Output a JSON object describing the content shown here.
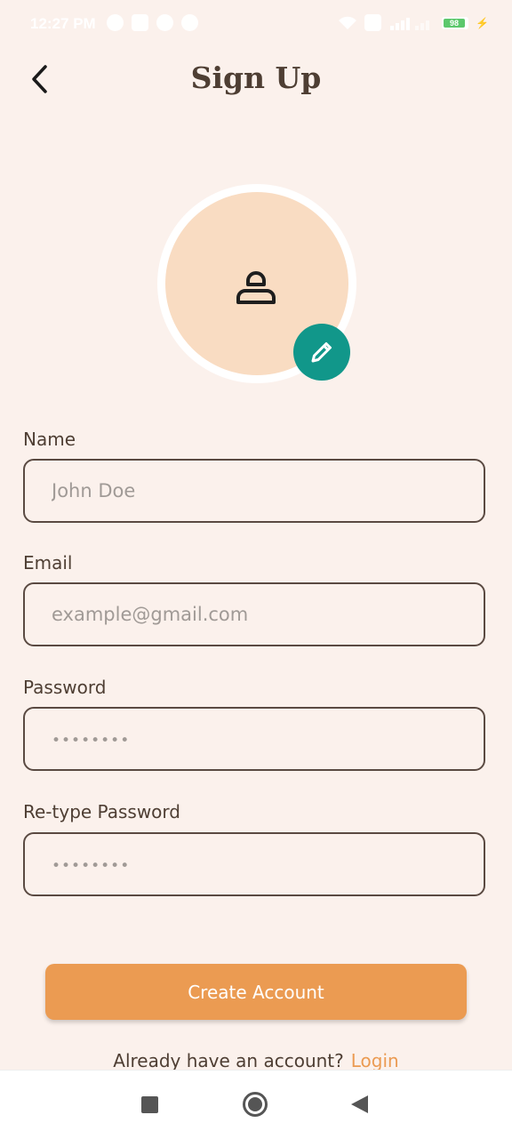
{
  "status_bar": {
    "time": "12:27 PM",
    "battery_level": "98",
    "icons": [
      "alarm-icon",
      "message-icon",
      "settings-icon",
      "chrome-icon",
      "wifi-icon",
      "screen-icon",
      "signal-icon",
      "battery-icon",
      "charging-icon"
    ]
  },
  "header": {
    "title": "Sign Up",
    "back_icon": "chevron-left-icon"
  },
  "avatar": {
    "placeholder_icon": "person-icon",
    "edit_icon": "pencil-icon",
    "edit_button_color": "#11978a",
    "avatar_color": "#f9dcc2"
  },
  "form": {
    "name": {
      "label": "Name",
      "placeholder": "John Doe"
    },
    "email": {
      "label": "Email",
      "placeholder": "example@gmail.com"
    },
    "password": {
      "label": "Password",
      "placeholder": "••••••••"
    },
    "retype_password": {
      "label": "Re-type Password",
      "placeholder": "••••••••"
    }
  },
  "actions": {
    "create_account": "Create Account",
    "create_account_color": "#eb9b52",
    "have_account_text": "Already have an account?",
    "login_link": "Login"
  },
  "nav_bar": {
    "icons": [
      "recents-icon",
      "home-icon",
      "back-icon"
    ]
  },
  "colors": {
    "background": "#fbf1ec",
    "text": "#4e3e33",
    "accent": "#eb9b52"
  }
}
